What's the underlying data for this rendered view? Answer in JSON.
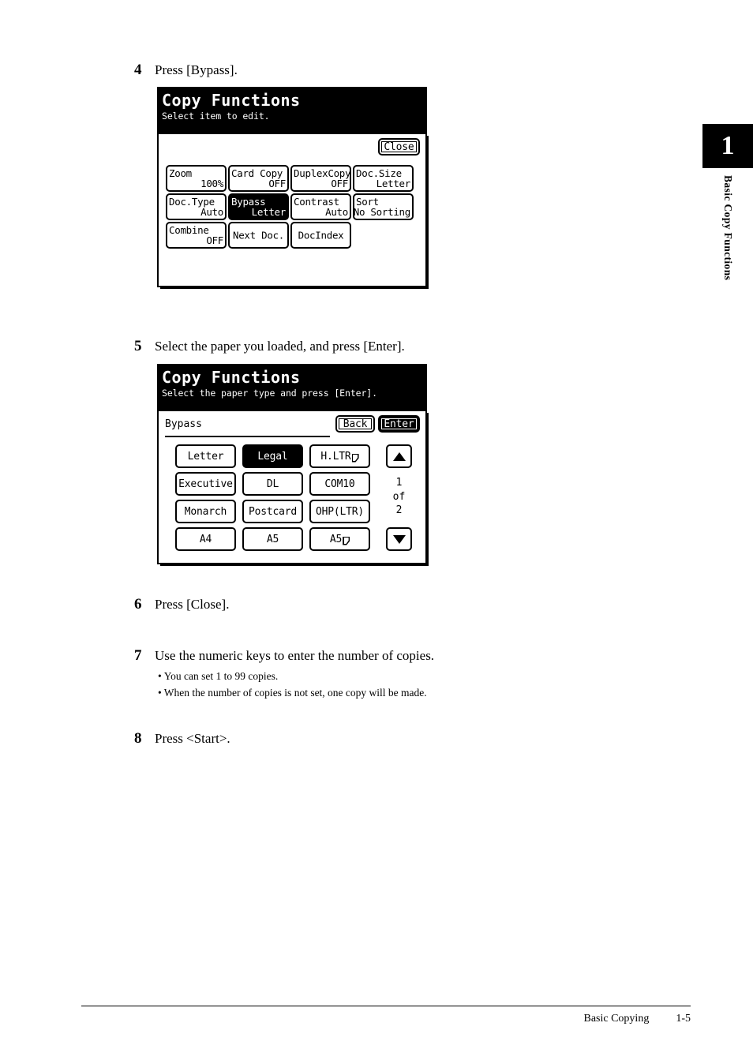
{
  "chapter": {
    "number": "1",
    "label": "Basic Copy Functions"
  },
  "footer": {
    "section": "Basic Copying",
    "page": "1-5"
  },
  "steps": [
    {
      "num": "4",
      "text": "Press [Bypass]."
    },
    {
      "num": "5",
      "text": "Select the paper you loaded, and press [Enter]."
    },
    {
      "num": "6",
      "text": "Press [Close]."
    },
    {
      "num": "7",
      "text": "Use the numeric keys to enter the number of copies."
    },
    {
      "num": "8",
      "text": "Press <Start>."
    }
  ],
  "step7_bullets": [
    "You can set 1 to 99 copies.",
    "When the number of copies is not set, one copy will be made."
  ],
  "panel1": {
    "title": "Copy Functions",
    "subtitle": "Select item to edit.",
    "close_label": "Close",
    "keys": [
      {
        "line1": "Zoom",
        "line2": "100%",
        "selected": false
      },
      {
        "line1": "Card Copy",
        "line2": "OFF",
        "selected": false
      },
      {
        "line1": "DuplexCopy",
        "line2": "OFF",
        "selected": false
      },
      {
        "line1": "Doc.Size",
        "line2": "Letter",
        "selected": false
      },
      {
        "line1": "Doc.Type",
        "line2": "Auto",
        "selected": false
      },
      {
        "line1": "Bypass",
        "line2": "Letter",
        "selected": true
      },
      {
        "line1": "Contrast",
        "line2": "Auto",
        "selected": false
      },
      {
        "line1": "Sort",
        "line2": "No Sorting",
        "selected": false
      },
      {
        "line1": "Combine",
        "line2": "OFF",
        "selected": false
      },
      {
        "line1": "Next Doc.",
        "line2": "",
        "selected": false
      },
      {
        "line1": "DocIndex",
        "line2": "",
        "selected": false
      }
    ]
  },
  "panel2": {
    "title": "Copy Functions",
    "subtitle": "Select the paper type and press [Enter].",
    "field_label": "Bypass",
    "back_label": "Back",
    "enter_label": "Enter",
    "page_counter": {
      "current": "1",
      "of": "of",
      "total": "2"
    },
    "scroll_up_icon": "triangle-up-icon",
    "scroll_down_icon": "triangle-down-icon",
    "paper_keys": [
      {
        "label": "Letter",
        "landscape": false,
        "selected": false
      },
      {
        "label": "Legal",
        "landscape": false,
        "selected": true
      },
      {
        "label": "H.LTR",
        "landscape": true,
        "selected": false
      },
      {
        "label": "Executive",
        "landscape": false,
        "selected": false
      },
      {
        "label": "DL",
        "landscape": false,
        "selected": false
      },
      {
        "label": "COM10",
        "landscape": false,
        "selected": false
      },
      {
        "label": "Monarch",
        "landscape": false,
        "selected": false
      },
      {
        "label": "Postcard",
        "landscape": false,
        "selected": false
      },
      {
        "label": "OHP(LTR)",
        "landscape": false,
        "selected": false
      },
      {
        "label": "A4",
        "landscape": false,
        "selected": false
      },
      {
        "label": "A5",
        "landscape": false,
        "selected": false
      },
      {
        "label": "A5",
        "landscape": true,
        "selected": false
      }
    ]
  }
}
